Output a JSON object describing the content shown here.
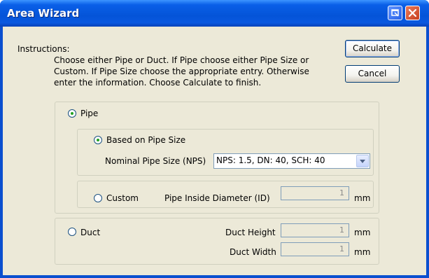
{
  "window": {
    "title": "Area Wizard"
  },
  "titlebar": {
    "restore_glyph": "⧉",
    "close_glyph": "✕"
  },
  "instructions": {
    "heading": "Instructions:",
    "lines": [
      "Choose either Pipe or Duct.  If Pipe choose either Pipe Size or",
      "Custom. If Pipe Size choose the appropriate entry.  Otherwise",
      "enter the information.  Choose Calculate to finish."
    ]
  },
  "buttons": {
    "calculate": "Calculate",
    "cancel": "Cancel"
  },
  "pipe": {
    "label": "Pipe",
    "selected": true,
    "size": {
      "label": "Based on Pipe Size",
      "selected": true,
      "nps_label": "Nominal Pipe Size (NPS)",
      "nps_value": "NPS:  1.5, DN: 40, SCH: 40"
    },
    "custom": {
      "label": "Custom",
      "selected": false,
      "id_label": "Pipe Inside Diameter (ID)",
      "id_value": "1",
      "id_unit": "mm"
    }
  },
  "duct": {
    "label": "Duct",
    "selected": false,
    "height_label": "Duct Height",
    "height_value": "1",
    "height_unit": "mm",
    "width_label": "Duct Width",
    "width_value": "1",
    "width_unit": "mm"
  }
}
